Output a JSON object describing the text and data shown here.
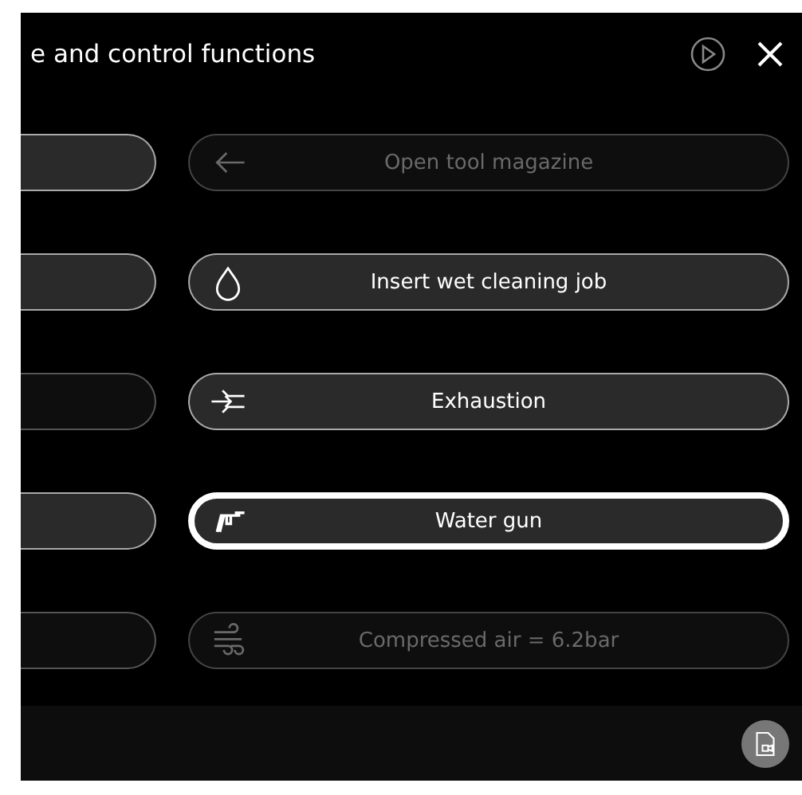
{
  "header": {
    "title": "e and control functions"
  },
  "rows": [
    {
      "side_button": {
        "disabled": false
      },
      "action": {
        "kind": "arrow",
        "label": "Open tool magazine",
        "disabled": true,
        "selected": false
      }
    },
    {
      "side_button": {
        "disabled": false
      },
      "action": {
        "kind": "drop",
        "label": "Insert wet cleaning job",
        "disabled": false,
        "selected": false
      }
    },
    {
      "side_button": {
        "disabled": true
      },
      "action": {
        "kind": "exhaust",
        "label": "Exhaustion",
        "disabled": false,
        "selected": false
      }
    },
    {
      "side_button": {
        "disabled": false
      },
      "action": {
        "kind": "gun",
        "label": "Water gun",
        "disabled": false,
        "selected": true
      }
    },
    {
      "side_button": {
        "disabled": true
      },
      "action": {
        "kind": "air",
        "label": "Compressed air = 6.2bar",
        "disabled": true,
        "selected": false
      }
    }
  ]
}
